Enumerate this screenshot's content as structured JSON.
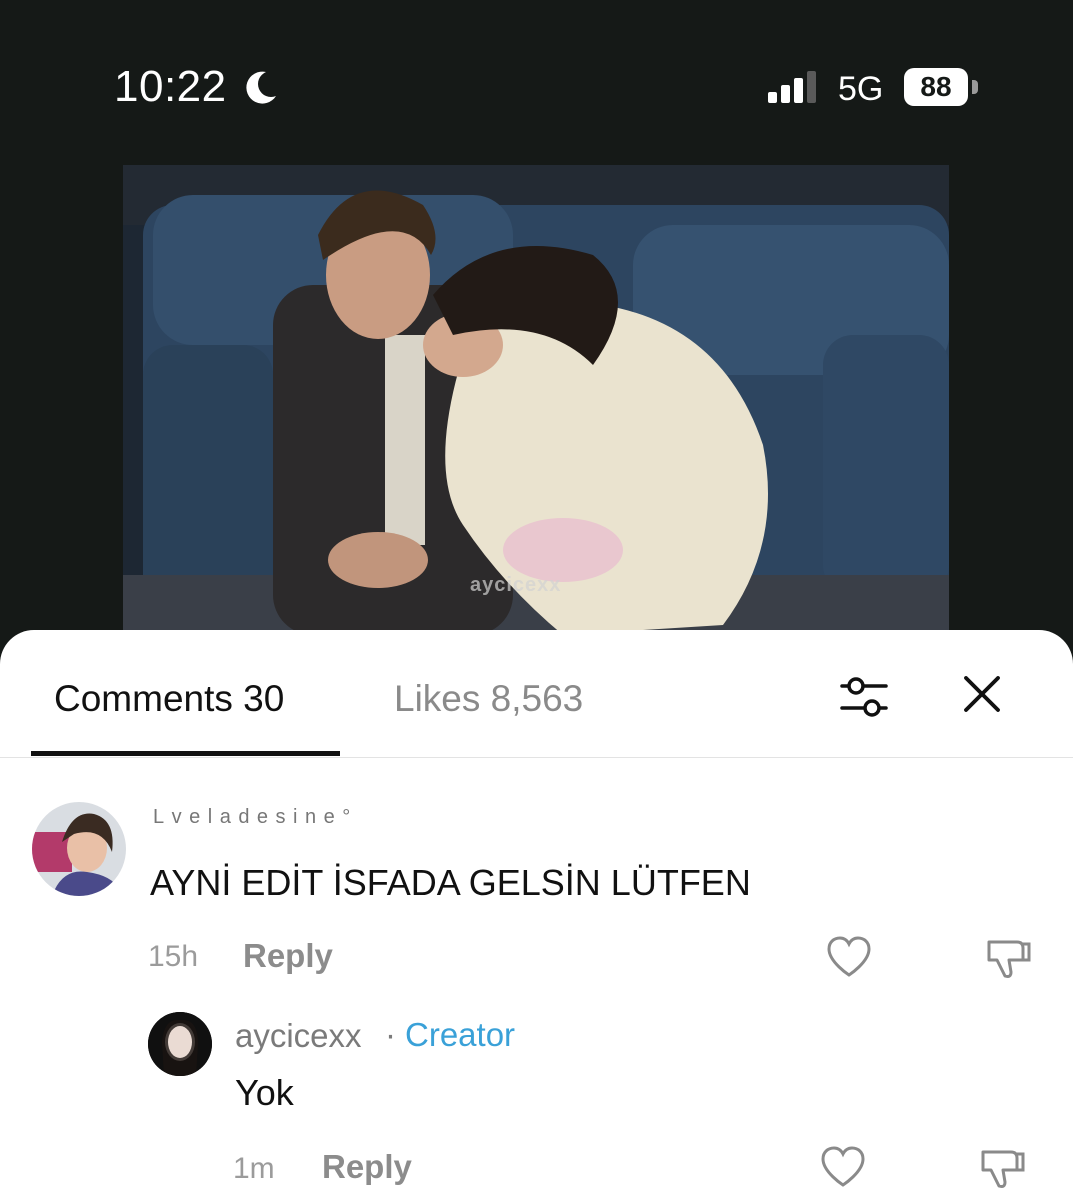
{
  "status_bar": {
    "time": "10:22",
    "network": "5G",
    "battery": "88"
  },
  "video": {
    "watermark": "aycicexx"
  },
  "tabs": {
    "comments": "Comments 30",
    "likes": "Likes 8,563"
  },
  "comments": [
    {
      "username": "Lveladesine°",
      "text": "AYNİ EDİT İSFADA GELSİN LÜTFEN",
      "time": "15h",
      "reply_label": "Reply"
    },
    {
      "username": "aycicexx",
      "separator": "·",
      "badge": "Creator",
      "text": "Yok",
      "time": "1m",
      "reply_label": "Reply"
    }
  ],
  "icons": [
    "moon-icon",
    "signal-icon",
    "battery-icon",
    "filter-icon",
    "close-icon",
    "heart-icon",
    "dislike-icon"
  ],
  "colors": {
    "background": "#151917",
    "sheet": "#ffffff",
    "creator_badge": "#3aa1d8"
  }
}
